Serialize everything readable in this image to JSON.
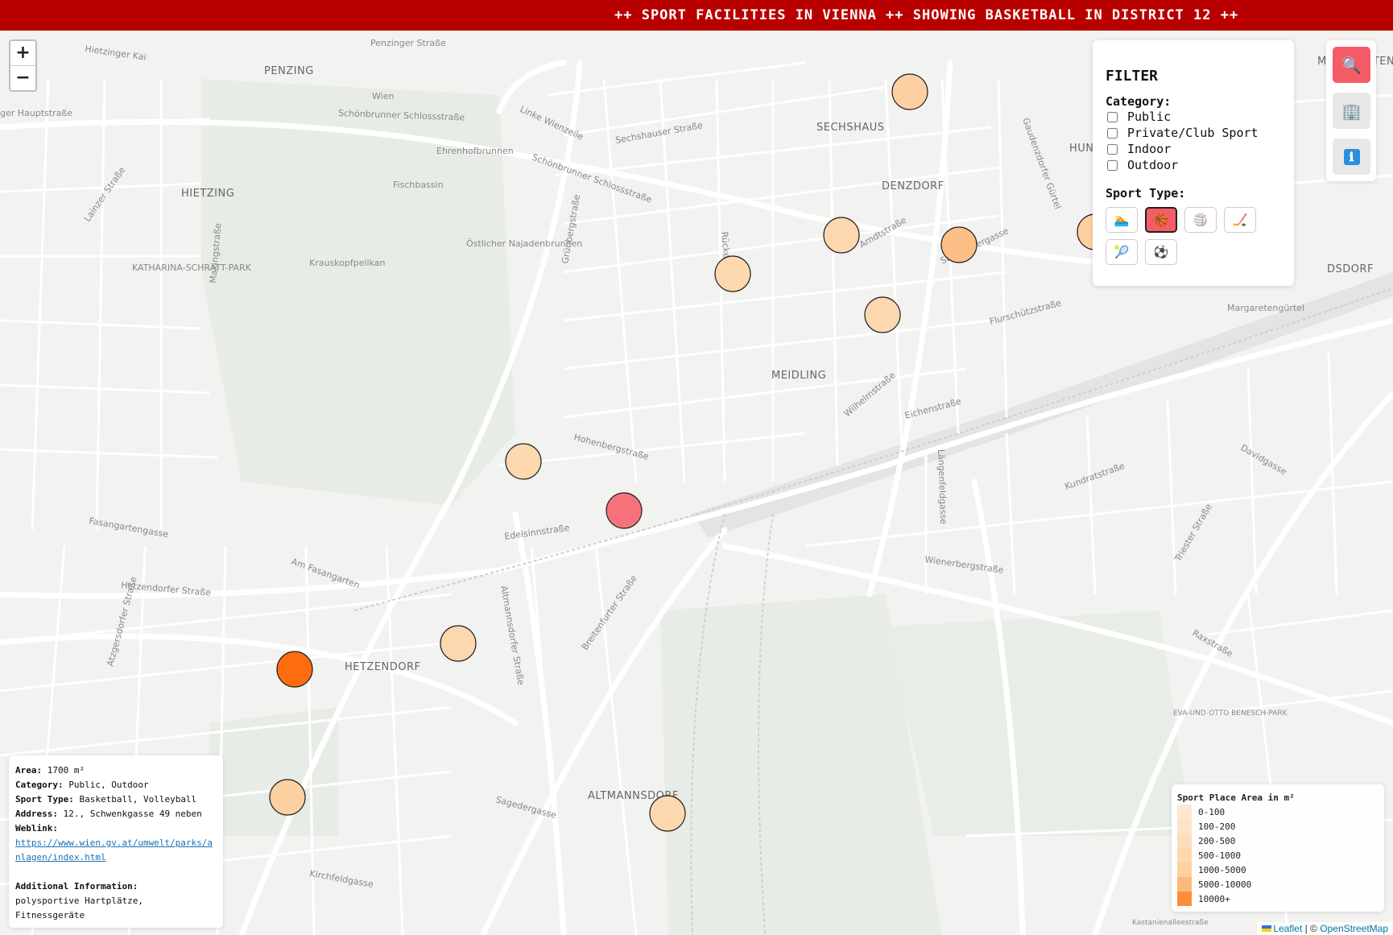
{
  "ticker": "++ SPORT FACILITIES IN VIENNA ++ SHOWING BASKETBALL IN DISTRICT 12 ++",
  "zoom": {
    "in": "+",
    "out": "−"
  },
  "map_labels": {
    "districts": [
      "PENZING",
      "SECHSHAUS",
      "HIETZING",
      "DENZDORF",
      "MEIDLING",
      "HETZENDORF",
      "ALTMANNSDORF",
      "HUN",
      "DSDORF",
      "MARGARETEN"
    ],
    "streets": [
      "Hietzinger Kai",
      "Penzinger Straße",
      "Wien",
      "Schönbrunner Schlossstraße",
      "ger Hauptstraße",
      "Linke Wienzeile",
      "Sechshauser Straße",
      "Ehrenhofbrunnen",
      "Fischbassin",
      "Lainzer Straße",
      "Maxingstraße",
      "Grünbergstraße",
      "Schönbrunner Schlossstraße",
      "Östlicher Najadenbrunnen",
      "Krauskopfpelikan",
      "KATHARINA-SCHRATT-PARK",
      "Rückergasse",
      "Arndtstraße",
      "Steinbauergasse",
      "Margaretengürtel",
      "Flurschützstraße",
      "Gaudenzdorfer Gürtel",
      "Längenfeldgasse",
      "Hohenbergstraße",
      "Eichenstraße",
      "Wilhelmstraße",
      "Edelsinnstraße",
      "Fasangartengasse",
      "Am Fasangarten",
      "Hetzendorfer Straße",
      "Atzgersdorfer Straße",
      "Altmannsdorfer Straße",
      "Breitenfurter Straße",
      "Wienerbergstraße",
      "Sagedergasse",
      "Kirchfeldgasse",
      "Kundratstraße",
      "Triester Straße",
      "Raxstraße",
      "EVA-UND-OTTO BENESCH-PARK",
      "Davidgasse",
      "Kastanienalleestraße"
    ]
  },
  "markers": [
    {
      "name": "marker-1",
      "size_class": "1000-5000",
      "color": "#fdd0a2"
    },
    {
      "name": "marker-2",
      "size_class": "500-1000",
      "color": "#fdd7ae"
    },
    {
      "name": "marker-3",
      "size_class": "5000-10000",
      "color": "#fdbf86"
    },
    {
      "name": "marker-4",
      "size_class": "500-1000",
      "color": "#fdd7ae"
    },
    {
      "name": "marker-5",
      "size_class": "500-1000",
      "color": "#fdd7ae"
    },
    {
      "name": "marker-6",
      "size_class": "500-1000",
      "color": "#fdd7ae"
    },
    {
      "name": "marker-7",
      "selected": true,
      "color": "#f7717d"
    },
    {
      "name": "marker-8",
      "size_class": "500-1000",
      "color": "#fdd7ae"
    },
    {
      "name": "marker-9",
      "size_class": "10000+",
      "color": "#fd6d10"
    },
    {
      "name": "marker-10",
      "size_class": "1000-5000",
      "color": "#fdd0a2"
    },
    {
      "name": "marker-11",
      "size_class": "500-1000",
      "color": "#fdd7ae"
    },
    {
      "name": "marker-12",
      "size_class": "1000-5000",
      "color": "#fdd0a2"
    }
  ],
  "filter": {
    "title": "FILTER",
    "category_label": "Category:",
    "categories": [
      "Public",
      "Private/Club Sport",
      "Indoor",
      "Outdoor"
    ],
    "sport_type_label": "Sport Type:",
    "sport_types": [
      {
        "icon": "swimming-icon",
        "glyph": "🏊",
        "active": false
      },
      {
        "icon": "basketball-icon",
        "glyph": "🏀",
        "active": true
      },
      {
        "icon": "volleyball-icon",
        "glyph": "🏐",
        "active": false
      },
      {
        "icon": "hockey-icon",
        "glyph": "🏒",
        "active": false
      },
      {
        "icon": "tennis-icon",
        "glyph": "🎾",
        "active": false
      },
      {
        "icon": "football-icon",
        "glyph": "⚽",
        "active": false
      }
    ]
  },
  "side_buttons": [
    {
      "icon": "search-icon",
      "glyph": "🔍",
      "active": true
    },
    {
      "icon": "building-icon",
      "glyph": "🏢",
      "active": false
    },
    {
      "icon": "info-icon",
      "glyph": "ℹ",
      "active": false
    }
  ],
  "info": {
    "area_label": "Area:",
    "area_value": "1700 m²",
    "category_label": "Category:",
    "category_value": "Public, Outdoor",
    "sport_label": "Sport Type:",
    "sport_value": "Basketball, Volleyball",
    "address_label": "Address:",
    "address_value": "12., Schwenkgasse 49 neben",
    "weblink_label": "Weblink:",
    "weblink_value": "https://www.wien.gv.at/umwelt/parks/anlagen/index.html",
    "additional_label": "Additional Information:",
    "additional_value": "polysportive Hartplätze, Fitnessgeräte"
  },
  "legend": {
    "title": "Sport Place Area in m²",
    "rows": [
      {
        "label": "0-100",
        "color": "#fee8d2"
      },
      {
        "label": "100-200",
        "color": "#fde3c8"
      },
      {
        "label": "200-500",
        "color": "#fdddbb"
      },
      {
        "label": "500-1000",
        "color": "#fdd7ae"
      },
      {
        "label": "1000-5000",
        "color": "#fdd0a2"
      },
      {
        "label": "5000-10000",
        "color": "#fdb97c"
      },
      {
        "label": "10000+",
        "color": "#fd8c3c"
      }
    ]
  },
  "attribution": {
    "leaflet": "Leaflet",
    "separator": " | © ",
    "osm": "OpenStreetMap"
  }
}
